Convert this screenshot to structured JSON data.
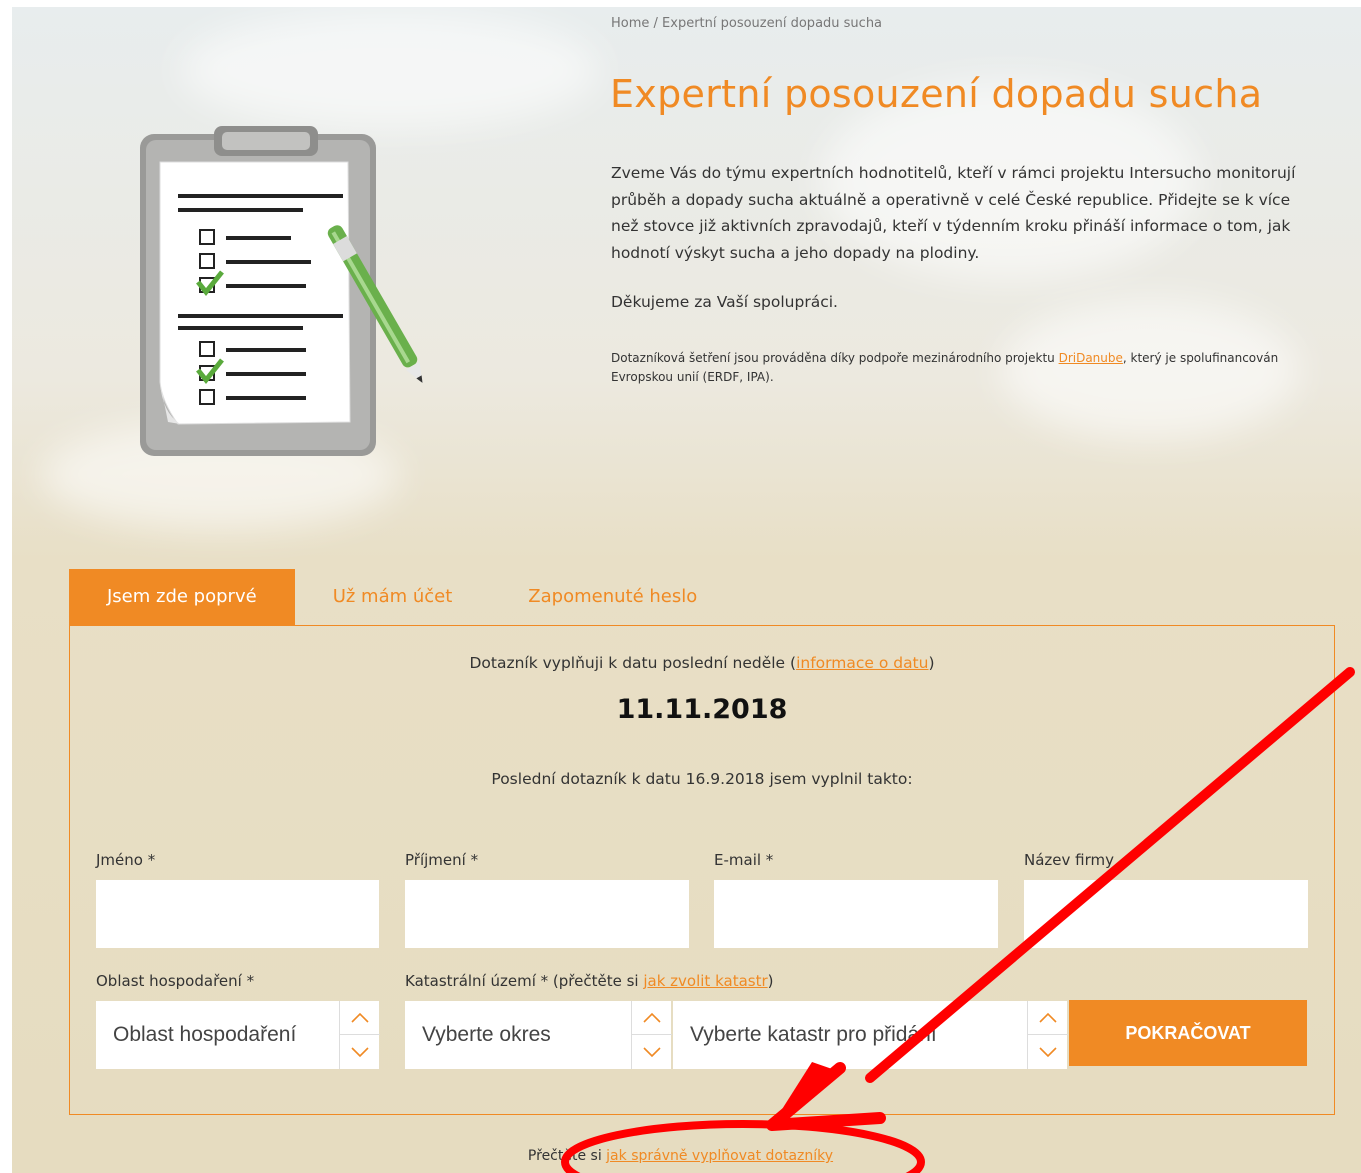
{
  "breadcrumb": {
    "home": "Home",
    "separator": " / ",
    "current": "Expertní posouzení dopadu sucha"
  },
  "page": {
    "title": "Expertní posouzení dopadu sucha",
    "intro": "Zveme Vás do týmu expertních hodnotitelů, kteří v rámci projektu Intersucho monitorují průběh a dopady sucha aktuálně a operativně v celé České republice. Přidejte se k více než stovce již aktivních zpravodajů, kteří v týdenním kroku přináší informace o tom, jak hodnotí výskyt sucha a jeho dopady na plodiny.",
    "thanks": "Děkujeme za Vaší spolupráci.",
    "note_before": "Dotazníková šetření jsou prováděna díky podpoře mezinárodního projektu ",
    "note_link": "DriDanube",
    "note_after": ", který je spolufinancován Evropskou unií (ERDF, IPA)."
  },
  "tabs": [
    {
      "label": "Jsem zde poprvé"
    },
    {
      "label": "Už mám účet"
    },
    {
      "label": "Zapomenuté heslo"
    }
  ],
  "form": {
    "date_line_before": "Dotazník vyplňuji k datu poslední neděle (",
    "date_line_link": "informace o datu",
    "date_line_after": ")",
    "date": "11.11.2018",
    "last_line": "Poslední dotazník k datu 16.9.2018 jsem vyplnil takto:",
    "labels": {
      "first_name": "Jméno *",
      "last_name": "Příjmení *",
      "email": "E-mail *",
      "company": "Název firmy",
      "area": "Oblast hospodaření *",
      "cadastre_before": "Katastrální území * (přečtěte si ",
      "cadastre_link": "jak zvolit katastr",
      "cadastre_after": ")"
    },
    "selects": {
      "area": "Oblast hospodaření",
      "district": "Vyberte okres",
      "cadastre": "Vyberte katastr pro přidání"
    },
    "continue_label": "POKRAČOVAT"
  },
  "footer": {
    "before": "Přečtěte si ",
    "link": "jak správně vyplňovat dotazníky"
  },
  "colors": {
    "accent": "#f08a24",
    "annotation": "#ff0000"
  }
}
